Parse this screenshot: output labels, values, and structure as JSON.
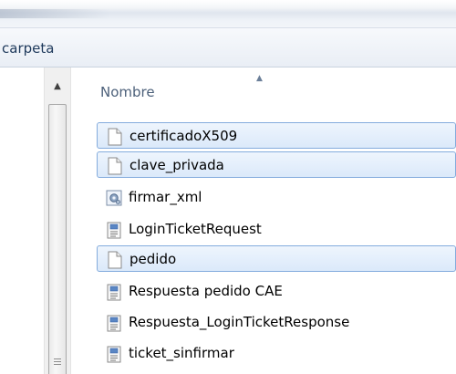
{
  "toolbar": {
    "new_folder_label": "carpeta"
  },
  "column": {
    "name_header": "Nombre"
  },
  "files": [
    {
      "name": "certificadoX509",
      "icon": "blank-file-icon",
      "selected": true
    },
    {
      "name": "clave_privada",
      "icon": "blank-file-icon",
      "selected": true
    },
    {
      "name": "firmar_xml",
      "icon": "gear-file-icon",
      "selected": false
    },
    {
      "name": "LoginTicketRequest",
      "icon": "xml-file-icon",
      "selected": false
    },
    {
      "name": "pedido",
      "icon": "blank-file-icon",
      "selected": true
    },
    {
      "name": "Respuesta pedido CAE",
      "icon": "xml-file-icon",
      "selected": false
    },
    {
      "name": "Respuesta_LoginTicketResponse",
      "icon": "xml-file-icon",
      "selected": false
    },
    {
      "name": "ticket_sinfirmar",
      "icon": "xml-file-icon",
      "selected": false
    }
  ],
  "colors": {
    "selection_border": "#84acdd",
    "selection_fill": "#dbe9fa",
    "header_text": "#4c607a"
  }
}
